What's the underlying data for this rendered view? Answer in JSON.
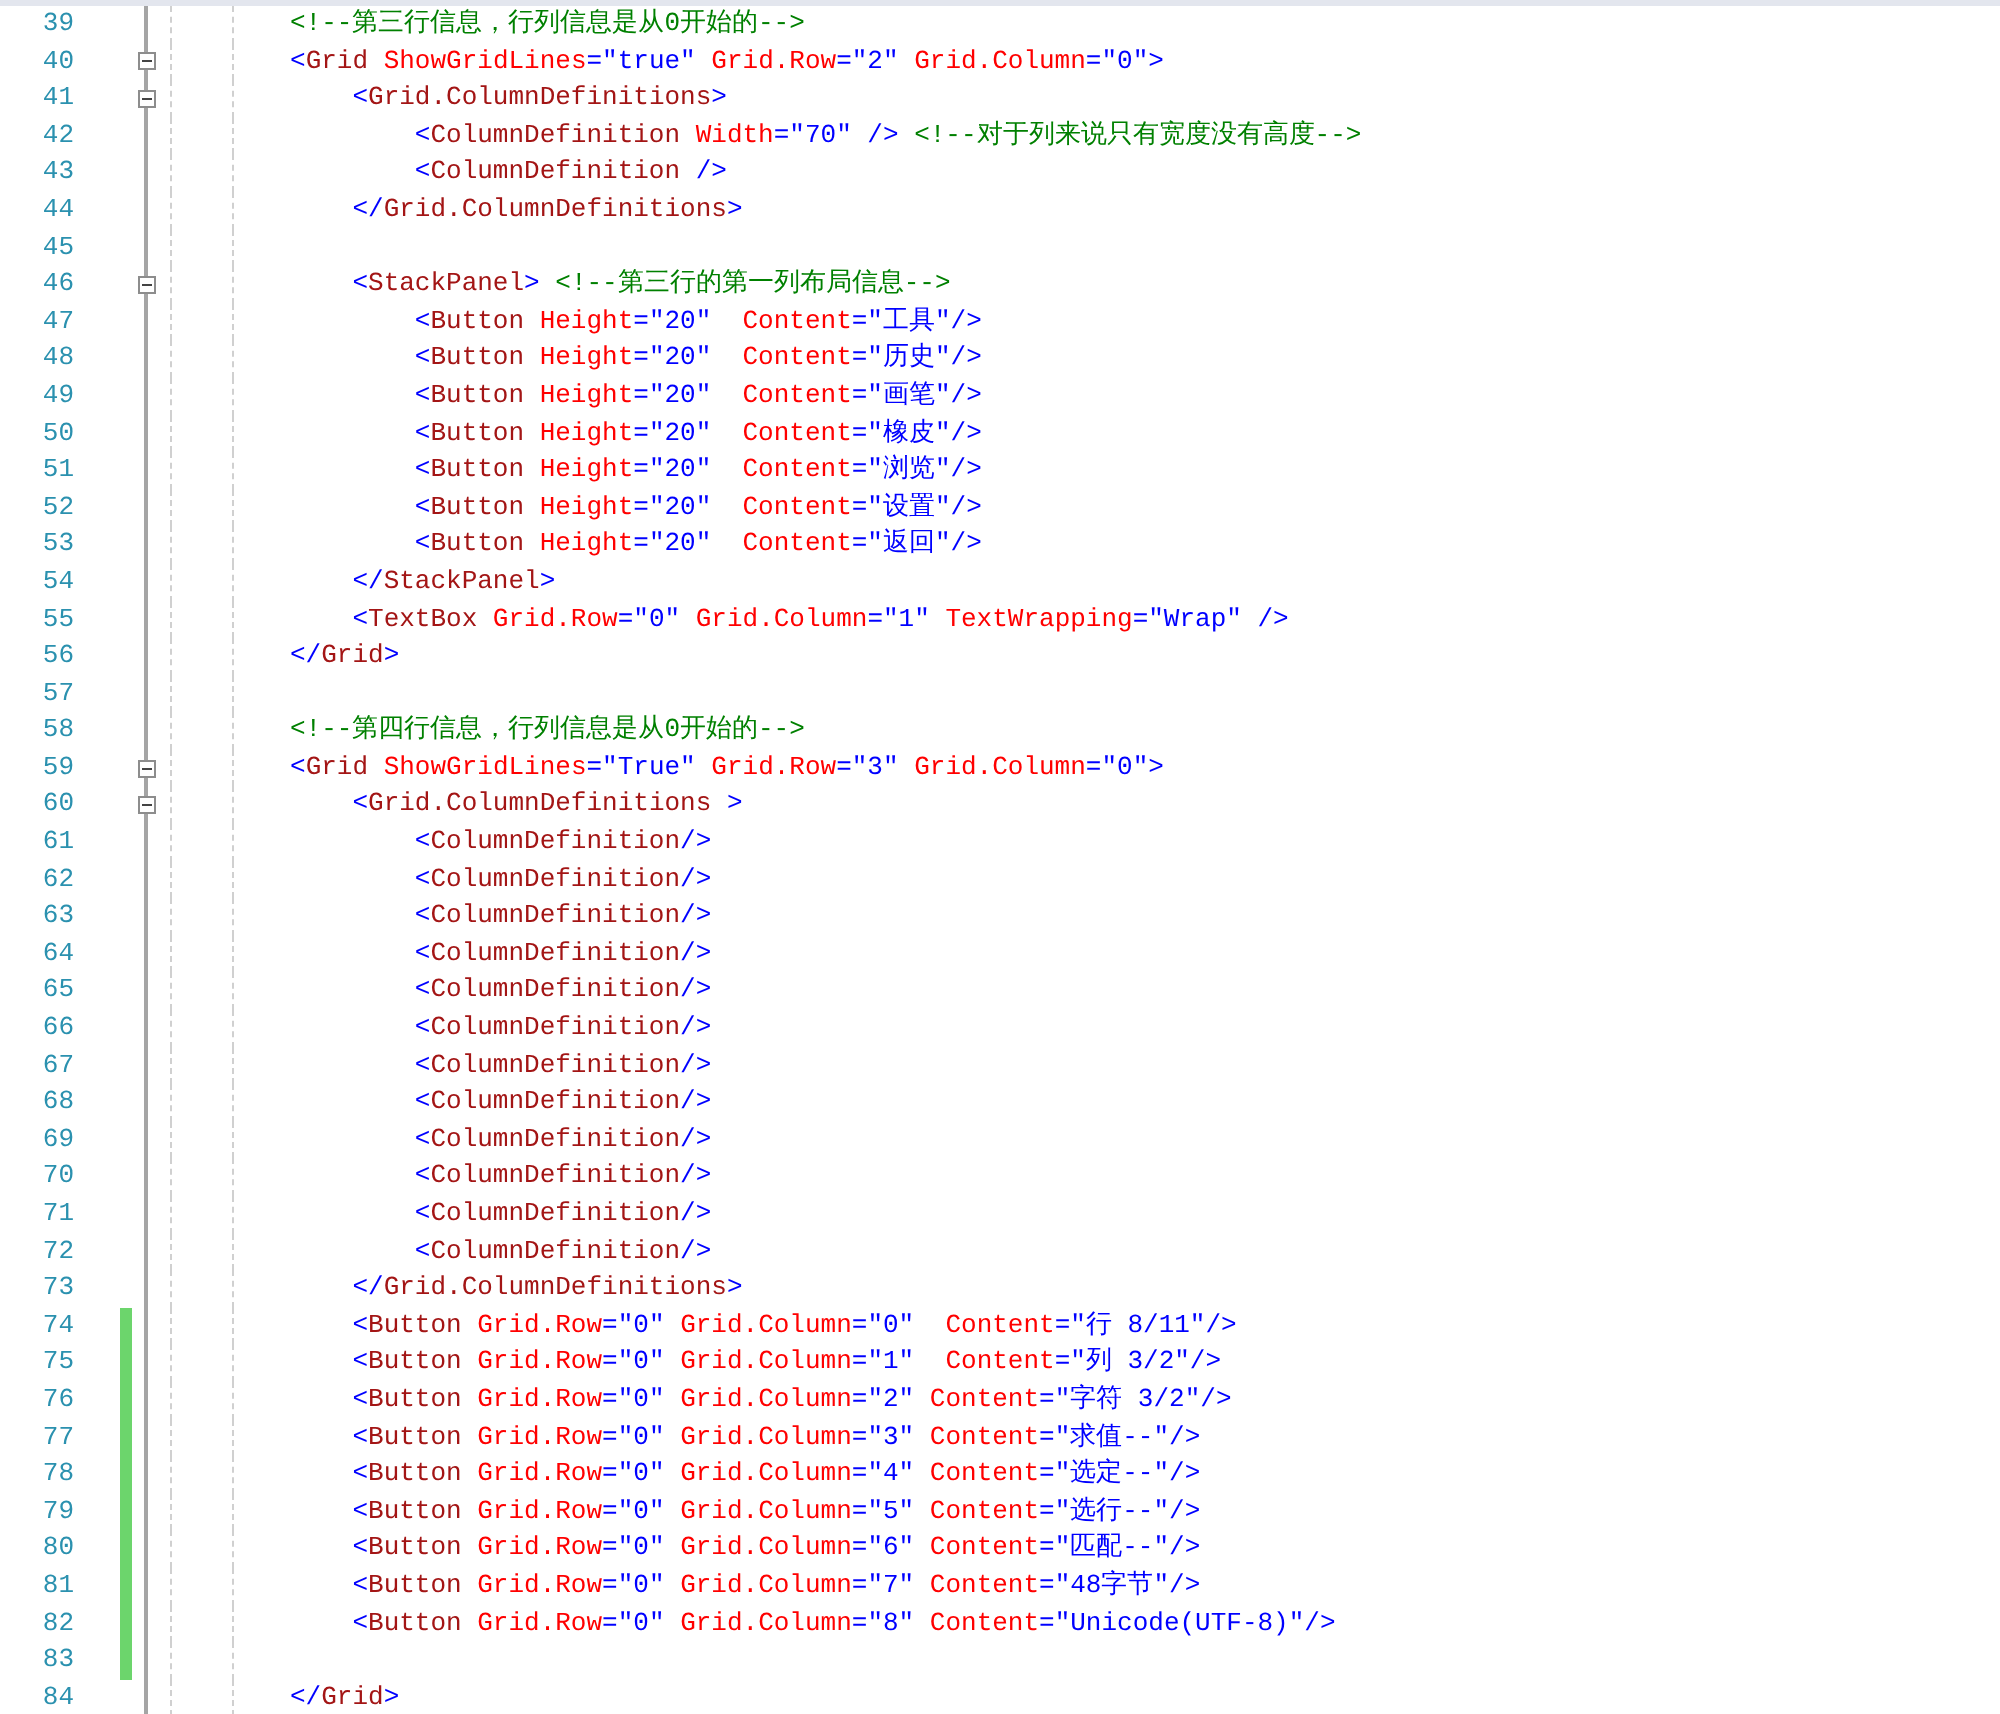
{
  "editor": {
    "lines": [
      {
        "number": "39",
        "changed": false,
        "tokens": [
          {
            "kind": "comment",
            "text": "<!--第三行信息，行列信息是从0开始的-->"
          }
        ]
      },
      {
        "number": "40",
        "changed": false,
        "expanded": true,
        "tokens": [
          {
            "kind": "markup",
            "text": "<"
          },
          {
            "kind": "element",
            "text": "Grid"
          },
          {
            "kind": "attribute",
            "text": " ShowGridLines"
          },
          {
            "kind": "markup",
            "text": "=\"true\""
          },
          {
            "kind": "attribute",
            "text": " Grid.Row"
          },
          {
            "kind": "markup",
            "text": "=\"2\""
          },
          {
            "kind": "attribute",
            "text": " Grid.Column"
          },
          {
            "kind": "markup",
            "text": "=\"0\">"
          }
        ]
      },
      {
        "number": "41",
        "changed": false,
        "expanded": true,
        "tokens": [
          {
            "kind": "markup",
            "text": "    <"
          },
          {
            "kind": "element",
            "text": "Grid.ColumnDefinitions"
          },
          {
            "kind": "markup",
            "text": ">"
          }
        ]
      },
      {
        "number": "42",
        "changed": false,
        "tokens": [
          {
            "kind": "markup",
            "text": "        <"
          },
          {
            "kind": "element",
            "text": "ColumnDefinition"
          },
          {
            "kind": "attribute",
            "text": " Width"
          },
          {
            "kind": "markup",
            "text": "=\"70\" />"
          },
          {
            "kind": "comment",
            "text": " <!--对于列来说只有宽度没有高度-->"
          }
        ]
      },
      {
        "number": "43",
        "changed": false,
        "tokens": [
          {
            "kind": "markup",
            "text": "        <"
          },
          {
            "kind": "element",
            "text": "ColumnDefinition"
          },
          {
            "kind": "markup",
            "text": " />"
          }
        ]
      },
      {
        "number": "44",
        "changed": false,
        "tokens": [
          {
            "kind": "markup",
            "text": "    </"
          },
          {
            "kind": "element",
            "text": "Grid.ColumnDefinitions"
          },
          {
            "kind": "markup",
            "text": ">"
          }
        ]
      },
      {
        "number": "45",
        "changed": false
      },
      {
        "number": "46",
        "changed": false,
        "expanded": true,
        "tokens": [
          {
            "kind": "markup",
            "text": "    <"
          },
          {
            "kind": "element",
            "text": "StackPanel"
          },
          {
            "kind": "markup",
            "text": ">"
          },
          {
            "kind": "comment",
            "text": " <!--第三行的第一列布局信息-->"
          }
        ]
      },
      {
        "number": "47",
        "changed": false,
        "tokens": [
          {
            "kind": "markup",
            "text": "        <"
          },
          {
            "kind": "element",
            "text": "Button"
          },
          {
            "kind": "attribute",
            "text": " Height"
          },
          {
            "kind": "markup",
            "text": "=\"20\""
          },
          {
            "kind": "attribute",
            "text": "  Content"
          },
          {
            "kind": "markup",
            "text": "=\"工具\"/>"
          }
        ]
      },
      {
        "number": "48",
        "changed": false,
        "tokens": [
          {
            "kind": "markup",
            "text": "        <"
          },
          {
            "kind": "element",
            "text": "Button"
          },
          {
            "kind": "attribute",
            "text": " Height"
          },
          {
            "kind": "markup",
            "text": "=\"20\""
          },
          {
            "kind": "attribute",
            "text": "  Content"
          },
          {
            "kind": "markup",
            "text": "=\"历史\"/>"
          }
        ]
      },
      {
        "number": "49",
        "changed": false,
        "tokens": [
          {
            "kind": "markup",
            "text": "        <"
          },
          {
            "kind": "element",
            "text": "Button"
          },
          {
            "kind": "attribute",
            "text": " Height"
          },
          {
            "kind": "markup",
            "text": "=\"20\""
          },
          {
            "kind": "attribute",
            "text": "  Content"
          },
          {
            "kind": "markup",
            "text": "=\"画笔\"/>"
          }
        ]
      },
      {
        "number": "50",
        "changed": false,
        "tokens": [
          {
            "kind": "markup",
            "text": "        <"
          },
          {
            "kind": "element",
            "text": "Button"
          },
          {
            "kind": "attribute",
            "text": " Height"
          },
          {
            "kind": "markup",
            "text": "=\"20\""
          },
          {
            "kind": "attribute",
            "text": "  Content"
          },
          {
            "kind": "markup",
            "text": "=\"橡皮\"/>"
          }
        ]
      },
      {
        "number": "51",
        "changed": false,
        "tokens": [
          {
            "kind": "markup",
            "text": "        <"
          },
          {
            "kind": "element",
            "text": "Button"
          },
          {
            "kind": "attribute",
            "text": " Height"
          },
          {
            "kind": "markup",
            "text": "=\"20\""
          },
          {
            "kind": "attribute",
            "text": "  Content"
          },
          {
            "kind": "markup",
            "text": "=\"浏览\"/>"
          }
        ]
      },
      {
        "number": "52",
        "changed": false,
        "tokens": [
          {
            "kind": "markup",
            "text": "        <"
          },
          {
            "kind": "element",
            "text": "Button"
          },
          {
            "kind": "attribute",
            "text": " Height"
          },
          {
            "kind": "markup",
            "text": "=\"20\""
          },
          {
            "kind": "attribute",
            "text": "  Content"
          },
          {
            "kind": "markup",
            "text": "=\"设置\"/>"
          }
        ]
      },
      {
        "number": "53",
        "changed": false,
        "tokens": [
          {
            "kind": "markup",
            "text": "        <"
          },
          {
            "kind": "element",
            "text": "Button"
          },
          {
            "kind": "attribute",
            "text": " Height"
          },
          {
            "kind": "markup",
            "text": "=\"20\""
          },
          {
            "kind": "attribute",
            "text": "  Content"
          },
          {
            "kind": "markup",
            "text": "=\"返回\"/>"
          }
        ]
      },
      {
        "number": "54",
        "changed": false,
        "tokens": [
          {
            "kind": "markup",
            "text": "    </"
          },
          {
            "kind": "element",
            "text": "StackPanel"
          },
          {
            "kind": "markup",
            "text": ">"
          }
        ]
      },
      {
        "number": "55",
        "changed": false,
        "tokens": [
          {
            "kind": "markup",
            "text": "    <"
          },
          {
            "kind": "element",
            "text": "TextBox"
          },
          {
            "kind": "attribute",
            "text": " Grid.Row"
          },
          {
            "kind": "markup",
            "text": "=\"0\""
          },
          {
            "kind": "attribute",
            "text": " Grid.Column"
          },
          {
            "kind": "markup",
            "text": "=\"1\""
          },
          {
            "kind": "attribute",
            "text": " TextWrapping"
          },
          {
            "kind": "markup",
            "text": "=\"Wrap\" />"
          }
        ]
      },
      {
        "number": "56",
        "changed": false,
        "tokens": [
          {
            "kind": "markup",
            "text": "</"
          },
          {
            "kind": "element",
            "text": "Grid"
          },
          {
            "kind": "markup",
            "text": ">"
          }
        ]
      },
      {
        "number": "57",
        "changed": false
      },
      {
        "number": "58",
        "changed": false,
        "tokens": [
          {
            "kind": "comment",
            "text": "<!--第四行信息，行列信息是从0开始的-->"
          }
        ]
      },
      {
        "number": "59",
        "changed": false,
        "expanded": true,
        "tokens": [
          {
            "kind": "markup",
            "text": "<"
          },
          {
            "kind": "element",
            "text": "Grid"
          },
          {
            "kind": "attribute",
            "text": " ShowGridLines"
          },
          {
            "kind": "markup",
            "text": "=\"True\""
          },
          {
            "kind": "attribute",
            "text": " Grid.Row"
          },
          {
            "kind": "markup",
            "text": "=\"3\""
          },
          {
            "kind": "attribute",
            "text": " Grid.Column"
          },
          {
            "kind": "markup",
            "text": "=\"0\">"
          }
        ]
      },
      {
        "number": "60",
        "changed": false,
        "expanded": true,
        "tokens": [
          {
            "kind": "markup",
            "text": "    <"
          },
          {
            "kind": "element",
            "text": "Grid.ColumnDefinitions"
          },
          {
            "kind": "markup",
            "text": " >"
          }
        ]
      },
      {
        "number": "61",
        "changed": false,
        "tokens": [
          {
            "kind": "markup",
            "text": "        <"
          },
          {
            "kind": "element",
            "text": "ColumnDefinition"
          },
          {
            "kind": "markup",
            "text": "/>"
          }
        ]
      },
      {
        "number": "62",
        "changed": false,
        "tokens": [
          {
            "kind": "markup",
            "text": "        <"
          },
          {
            "kind": "element",
            "text": "ColumnDefinition"
          },
          {
            "kind": "markup",
            "text": "/>"
          }
        ]
      },
      {
        "number": "63",
        "changed": false,
        "tokens": [
          {
            "kind": "markup",
            "text": "        <"
          },
          {
            "kind": "element",
            "text": "ColumnDefinition"
          },
          {
            "kind": "markup",
            "text": "/>"
          }
        ]
      },
      {
        "number": "64",
        "changed": false,
        "tokens": [
          {
            "kind": "markup",
            "text": "        <"
          },
          {
            "kind": "element",
            "text": "ColumnDefinition"
          },
          {
            "kind": "markup",
            "text": "/>"
          }
        ]
      },
      {
        "number": "65",
        "changed": false,
        "tokens": [
          {
            "kind": "markup",
            "text": "        <"
          },
          {
            "kind": "element",
            "text": "ColumnDefinition"
          },
          {
            "kind": "markup",
            "text": "/>"
          }
        ]
      },
      {
        "number": "66",
        "changed": false,
        "tokens": [
          {
            "kind": "markup",
            "text": "        <"
          },
          {
            "kind": "element",
            "text": "ColumnDefinition"
          },
          {
            "kind": "markup",
            "text": "/>"
          }
        ]
      },
      {
        "number": "67",
        "changed": false,
        "tokens": [
          {
            "kind": "markup",
            "text": "        <"
          },
          {
            "kind": "element",
            "text": "ColumnDefinition"
          },
          {
            "kind": "markup",
            "text": "/>"
          }
        ]
      },
      {
        "number": "68",
        "changed": false,
        "tokens": [
          {
            "kind": "markup",
            "text": "        <"
          },
          {
            "kind": "element",
            "text": "ColumnDefinition"
          },
          {
            "kind": "markup",
            "text": "/>"
          }
        ]
      },
      {
        "number": "69",
        "changed": false,
        "tokens": [
          {
            "kind": "markup",
            "text": "        <"
          },
          {
            "kind": "element",
            "text": "ColumnDefinition"
          },
          {
            "kind": "markup",
            "text": "/>"
          }
        ]
      },
      {
        "number": "70",
        "changed": false,
        "tokens": [
          {
            "kind": "markup",
            "text": "        <"
          },
          {
            "kind": "element",
            "text": "ColumnDefinition"
          },
          {
            "kind": "markup",
            "text": "/>"
          }
        ]
      },
      {
        "number": "71",
        "changed": false,
        "tokens": [
          {
            "kind": "markup",
            "text": "        <"
          },
          {
            "kind": "element",
            "text": "ColumnDefinition"
          },
          {
            "kind": "markup",
            "text": "/>"
          }
        ]
      },
      {
        "number": "72",
        "changed": false,
        "tokens": [
          {
            "kind": "markup",
            "text": "        <"
          },
          {
            "kind": "element",
            "text": "ColumnDefinition"
          },
          {
            "kind": "markup",
            "text": "/>"
          }
        ]
      },
      {
        "number": "73",
        "changed": false,
        "tokens": [
          {
            "kind": "markup",
            "text": "    </"
          },
          {
            "kind": "element",
            "text": "Grid.ColumnDefinitions"
          },
          {
            "kind": "markup",
            "text": ">"
          }
        ]
      },
      {
        "number": "74",
        "changed": true,
        "tokens": [
          {
            "kind": "markup",
            "text": "    <"
          },
          {
            "kind": "element",
            "text": "Button"
          },
          {
            "kind": "attribute",
            "text": " Grid.Row"
          },
          {
            "kind": "markup",
            "text": "=\"0\""
          },
          {
            "kind": "attribute",
            "text": " Grid.Column"
          },
          {
            "kind": "markup",
            "text": "=\"0\""
          },
          {
            "kind": "attribute",
            "text": "  Content"
          },
          {
            "kind": "markup",
            "text": "=\"行 8/11\"/>"
          }
        ]
      },
      {
        "number": "75",
        "changed": true,
        "tokens": [
          {
            "kind": "markup",
            "text": "    <"
          },
          {
            "kind": "element",
            "text": "Button"
          },
          {
            "kind": "attribute",
            "text": " Grid.Row"
          },
          {
            "kind": "markup",
            "text": "=\"0\""
          },
          {
            "kind": "attribute",
            "text": " Grid.Column"
          },
          {
            "kind": "markup",
            "text": "=\"1\""
          },
          {
            "kind": "attribute",
            "text": "  Content"
          },
          {
            "kind": "markup",
            "text": "=\"列 3/2\"/>"
          }
        ]
      },
      {
        "number": "76",
        "changed": true,
        "tokens": [
          {
            "kind": "markup",
            "text": "    <"
          },
          {
            "kind": "element",
            "text": "Button"
          },
          {
            "kind": "attribute",
            "text": " Grid.Row"
          },
          {
            "kind": "markup",
            "text": "=\"0\""
          },
          {
            "kind": "attribute",
            "text": " Grid.Column"
          },
          {
            "kind": "markup",
            "text": "=\"2\""
          },
          {
            "kind": "attribute",
            "text": " Content"
          },
          {
            "kind": "markup",
            "text": "=\"字符 3/2\"/>"
          }
        ]
      },
      {
        "number": "77",
        "changed": true,
        "tokens": [
          {
            "kind": "markup",
            "text": "    <"
          },
          {
            "kind": "element",
            "text": "Button"
          },
          {
            "kind": "attribute",
            "text": " Grid.Row"
          },
          {
            "kind": "markup",
            "text": "=\"0\""
          },
          {
            "kind": "attribute",
            "text": " Grid.Column"
          },
          {
            "kind": "markup",
            "text": "=\"3\""
          },
          {
            "kind": "attribute",
            "text": " Content"
          },
          {
            "kind": "markup",
            "text": "=\"求值--\"/>"
          }
        ]
      },
      {
        "number": "78",
        "changed": true,
        "tokens": [
          {
            "kind": "markup",
            "text": "    <"
          },
          {
            "kind": "element",
            "text": "Button"
          },
          {
            "kind": "attribute",
            "text": " Grid.Row"
          },
          {
            "kind": "markup",
            "text": "=\"0\""
          },
          {
            "kind": "attribute",
            "text": " Grid.Column"
          },
          {
            "kind": "markup",
            "text": "=\"4\""
          },
          {
            "kind": "attribute",
            "text": " Content"
          },
          {
            "kind": "markup",
            "text": "=\"选定--\"/>"
          }
        ]
      },
      {
        "number": "79",
        "changed": true,
        "tokens": [
          {
            "kind": "markup",
            "text": "    <"
          },
          {
            "kind": "element",
            "text": "Button"
          },
          {
            "kind": "attribute",
            "text": " Grid.Row"
          },
          {
            "kind": "markup",
            "text": "=\"0\""
          },
          {
            "kind": "attribute",
            "text": " Grid.Column"
          },
          {
            "kind": "markup",
            "text": "=\"5\""
          },
          {
            "kind": "attribute",
            "text": " Content"
          },
          {
            "kind": "markup",
            "text": "=\"选行--\"/>"
          }
        ]
      },
      {
        "number": "80",
        "changed": true,
        "tokens": [
          {
            "kind": "markup",
            "text": "    <"
          },
          {
            "kind": "element",
            "text": "Button"
          },
          {
            "kind": "attribute",
            "text": " Grid.Row"
          },
          {
            "kind": "markup",
            "text": "=\"0\""
          },
          {
            "kind": "attribute",
            "text": " Grid.Column"
          },
          {
            "kind": "markup",
            "text": "=\"6\""
          },
          {
            "kind": "attribute",
            "text": " Content"
          },
          {
            "kind": "markup",
            "text": "=\"匹配--\"/>"
          }
        ]
      },
      {
        "number": "81",
        "changed": true,
        "tokens": [
          {
            "kind": "markup",
            "text": "    <"
          },
          {
            "kind": "element",
            "text": "Button"
          },
          {
            "kind": "attribute",
            "text": " Grid.Row"
          },
          {
            "kind": "markup",
            "text": "=\"0\""
          },
          {
            "kind": "attribute",
            "text": " Grid.Column"
          },
          {
            "kind": "markup",
            "text": "=\"7\""
          },
          {
            "kind": "attribute",
            "text": " Content"
          },
          {
            "kind": "markup",
            "text": "=\"48字节\"/>"
          }
        ]
      },
      {
        "number": "82",
        "changed": true,
        "tokens": [
          {
            "kind": "markup",
            "text": "    <"
          },
          {
            "kind": "element",
            "text": "Button"
          },
          {
            "kind": "attribute",
            "text": " Grid.Row"
          },
          {
            "kind": "markup",
            "text": "=\"0\""
          },
          {
            "kind": "attribute",
            "text": " Grid.Column"
          },
          {
            "kind": "markup",
            "text": "=\"8\""
          },
          {
            "kind": "attribute",
            "text": " Content"
          },
          {
            "kind": "markup",
            "text": "=\"Unicode(UTF-8)\"/>"
          }
        ]
      },
      {
        "number": "83",
        "changed": true
      },
      {
        "number": "84",
        "changed": false,
        "tokens": [
          {
            "kind": "markup",
            "text": "</"
          },
          {
            "kind": "element",
            "text": "Grid"
          },
          {
            "kind": "markup",
            "text": ">"
          }
        ]
      }
    ]
  }
}
